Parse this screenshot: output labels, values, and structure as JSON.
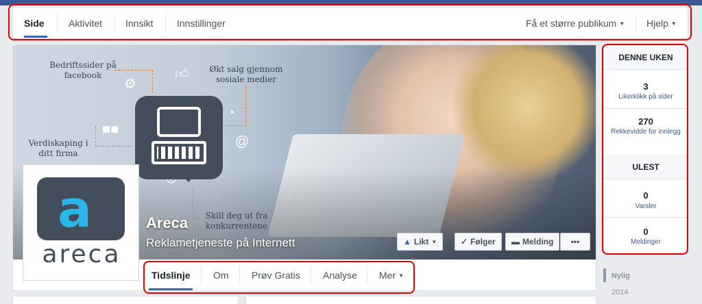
{
  "topnav": {
    "items": [
      "Side",
      "Aktivitet",
      "Innsikt",
      "Innstillinger"
    ],
    "right": [
      "Få et større publikum",
      "Hjelp"
    ]
  },
  "cover": {
    "infographic": {
      "bedriftssider": "Bedriftssider på facebook",
      "okt_salg": "Økt salg gjennom sosiale medier",
      "verdiskaping": "Verdiskaping i ditt firma",
      "skill_deg": "Skill deg ut fra konkurrentene"
    },
    "page_name": "Areca",
    "page_category": "Reklametjeneste på Internett",
    "logo_word": "areca",
    "buttons": {
      "like": "Likt",
      "follow": "Følger",
      "message": "Melding",
      "more": "•••"
    }
  },
  "tabs": [
    "Tidslinje",
    "Om",
    "Prøv Gratis",
    "Analyse",
    "Mer"
  ],
  "sidebar": {
    "this_week_header": "DENNE UKEN",
    "likes_count": "3",
    "likes_label": "Likerklikk på sider",
    "reach_count": "270",
    "reach_label": "Rekkevidde for innlegg",
    "unread_header": "ULEST",
    "notifications_count": "0",
    "notifications_label": "Varsler",
    "messages_count": "0",
    "messages_label": "Meldinger"
  },
  "years": [
    "Nylig",
    "2014"
  ],
  "colors": {
    "facebook_blue": "#4267b2",
    "highlight_red": "#e00000",
    "accent_cyan": "#29b6e8",
    "monitor_dark": "#444d5c"
  }
}
